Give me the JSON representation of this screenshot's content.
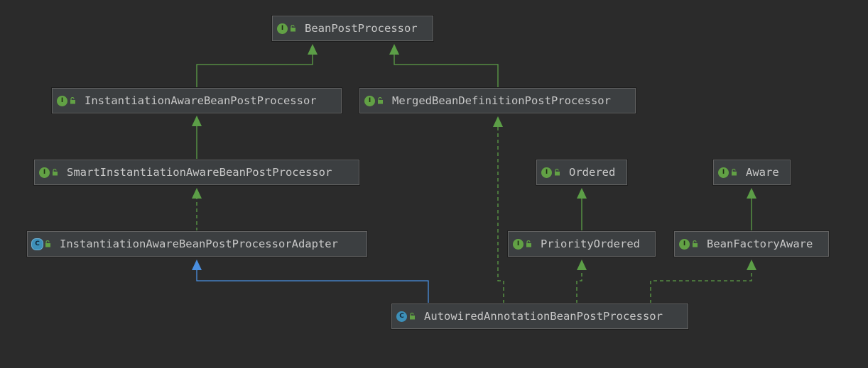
{
  "nodes": {
    "bean_post_processor": {
      "label": "BeanPostProcessor",
      "kind": "interface",
      "kind_letter": "I"
    },
    "instantiation_aware": {
      "label": "InstantiationAwareBeanPostProcessor",
      "kind": "interface",
      "kind_letter": "I"
    },
    "merged_bean_definition": {
      "label": "MergedBeanDefinitionPostProcessor",
      "kind": "interface",
      "kind_letter": "I"
    },
    "smart_instantiation_aware": {
      "label": "SmartInstantiationAwareBeanPostProcessor",
      "kind": "interface",
      "kind_letter": "I"
    },
    "instantiation_adapter": {
      "label": "InstantiationAwareBeanPostProcessorAdapter",
      "kind": "abstract-class",
      "kind_letter": "C"
    },
    "ordered": {
      "label": "Ordered",
      "kind": "interface",
      "kind_letter": "I"
    },
    "aware": {
      "label": "Aware",
      "kind": "interface",
      "kind_letter": "I"
    },
    "priority_ordered": {
      "label": "PriorityOrdered",
      "kind": "interface",
      "kind_letter": "I"
    },
    "bean_factory_aware": {
      "label": "BeanFactoryAware",
      "kind": "interface",
      "kind_letter": "I"
    },
    "autowired": {
      "label": "AutowiredAnnotationBeanPostProcessor",
      "kind": "class",
      "kind_letter": "C"
    }
  },
  "edges": [
    {
      "from": "instantiation_aware",
      "to": "bean_post_processor",
      "relation": "extends"
    },
    {
      "from": "merged_bean_definition",
      "to": "bean_post_processor",
      "relation": "extends"
    },
    {
      "from": "smart_instantiation_aware",
      "to": "instantiation_aware",
      "relation": "extends"
    },
    {
      "from": "instantiation_adapter",
      "to": "smart_instantiation_aware",
      "relation": "implements"
    },
    {
      "from": "priority_ordered",
      "to": "ordered",
      "relation": "extends"
    },
    {
      "from": "bean_factory_aware",
      "to": "aware",
      "relation": "extends"
    },
    {
      "from": "autowired",
      "to": "instantiation_adapter",
      "relation": "extends-class"
    },
    {
      "from": "autowired",
      "to": "merged_bean_definition",
      "relation": "implements"
    },
    {
      "from": "autowired",
      "to": "priority_ordered",
      "relation": "implements"
    },
    {
      "from": "autowired",
      "to": "bean_factory_aware",
      "relation": "implements"
    }
  ],
  "colors": {
    "background": "#2b2b2b",
    "interface_badge": "#62a145",
    "class_badge": "#3d8fb8",
    "interface_edge": "#5c9e47",
    "class_edge": "#4a8fe0"
  }
}
